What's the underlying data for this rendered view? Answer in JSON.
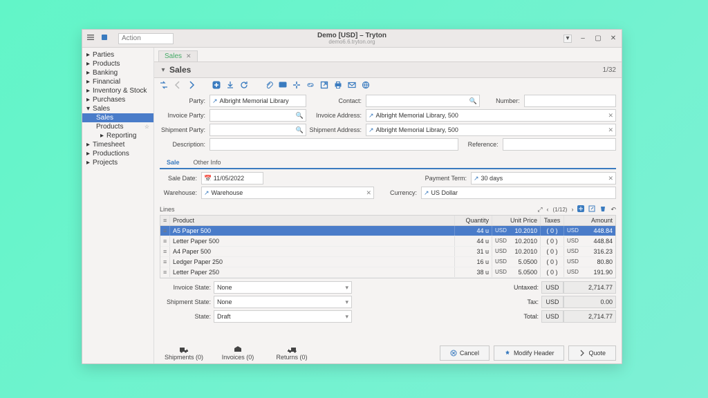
{
  "window": {
    "title": "Demo [USD] – Tryton",
    "subtitle": "demo6.6.tryton.org"
  },
  "action_placeholder": "Action",
  "sidebar": [
    {
      "label": "Parties",
      "icon": "user"
    },
    {
      "label": "Products",
      "icon": "grid"
    },
    {
      "label": "Banking",
      "icon": "bank"
    },
    {
      "label": "Financial",
      "icon": "doc"
    },
    {
      "label": "Inventory & Stock",
      "icon": "truck"
    },
    {
      "label": "Purchases",
      "icon": "cart"
    },
    {
      "label": "Sales",
      "icon": "tag",
      "expanded": true,
      "children": [
        {
          "label": "Sales",
          "active": true
        },
        {
          "label": "Products",
          "star": true
        },
        {
          "label": "Reporting",
          "icon": "folder"
        }
      ]
    },
    {
      "label": "Timesheet",
      "icon": "clock"
    },
    {
      "label": "Productions",
      "icon": "wrench"
    },
    {
      "label": "Projects",
      "icon": "briefcase"
    }
  ],
  "tab": {
    "label": "Sales"
  },
  "page": {
    "title": "Sales",
    "counter": "1/32"
  },
  "form": {
    "labels": {
      "party": "Party:",
      "contact": "Contact:",
      "number": "Number:",
      "invoice_party": "Invoice Party:",
      "invoice_address": "Invoice Address:",
      "shipment_party": "Shipment Party:",
      "shipment_address": "Shipment Address:",
      "description": "Description:",
      "reference": "Reference:"
    },
    "party": "Albright Memorial Library",
    "invoice_address": "Albright Memorial Library, 500",
    "shipment_address": "Albright Memorial Library, 500"
  },
  "subtabs": [
    "Sale",
    "Other Info"
  ],
  "sale": {
    "labels": {
      "sale_date": "Sale Date:",
      "payment_term": "Payment Term:",
      "warehouse": "Warehouse:",
      "currency": "Currency:"
    },
    "sale_date": "11/05/2022",
    "payment_term": "30 days",
    "warehouse": "Warehouse",
    "currency": "US Dollar"
  },
  "lines": {
    "title": "Lines",
    "pager": "(1/12)",
    "cols": {
      "product": "Product",
      "quantity": "Quantity",
      "unit_price": "Unit Price",
      "taxes": "Taxes",
      "amount": "Amount"
    },
    "rows": [
      {
        "product": "A5 Paper 500",
        "qty": "44 u",
        "cur": "USD",
        "unit_price": "10.2010",
        "taxes": "( 0 )",
        "amount": "448.84",
        "selected": true
      },
      {
        "product": "Letter Paper 500",
        "qty": "44 u",
        "cur": "USD",
        "unit_price": "10.2010",
        "taxes": "( 0 )",
        "amount": "448.84"
      },
      {
        "product": "A4 Paper 500",
        "qty": "31 u",
        "cur": "USD",
        "unit_price": "10.2010",
        "taxes": "( 0 )",
        "amount": "316.23"
      },
      {
        "product": "Ledger Paper 250",
        "qty": "16 u",
        "cur": "USD",
        "unit_price": "5.0500",
        "taxes": "( 0 )",
        "amount": "80.80"
      },
      {
        "product": "Letter Paper 250",
        "qty": "38 u",
        "cur": "USD",
        "unit_price": "5.0500",
        "taxes": "( 0 )",
        "amount": "191.90"
      }
    ]
  },
  "states": {
    "invoice_state_lbl": "Invoice State:",
    "invoice_state": "None",
    "shipment_state_lbl": "Shipment State:",
    "shipment_state": "None",
    "state_lbl": "State:",
    "state": "Draft"
  },
  "totals": {
    "untaxed_lbl": "Untaxed:",
    "untaxed": "2,714.77",
    "tax_lbl": "Tax:",
    "tax": "0.00",
    "total_lbl": "Total:",
    "total": "2,714.77",
    "cur": "USD"
  },
  "footer": {
    "shipments": "Shipments (0)",
    "invoices": "Invoices (0)",
    "returns": "Returns (0)",
    "cancel": "Cancel",
    "modify": "Modify Header",
    "quote": "Quote"
  }
}
